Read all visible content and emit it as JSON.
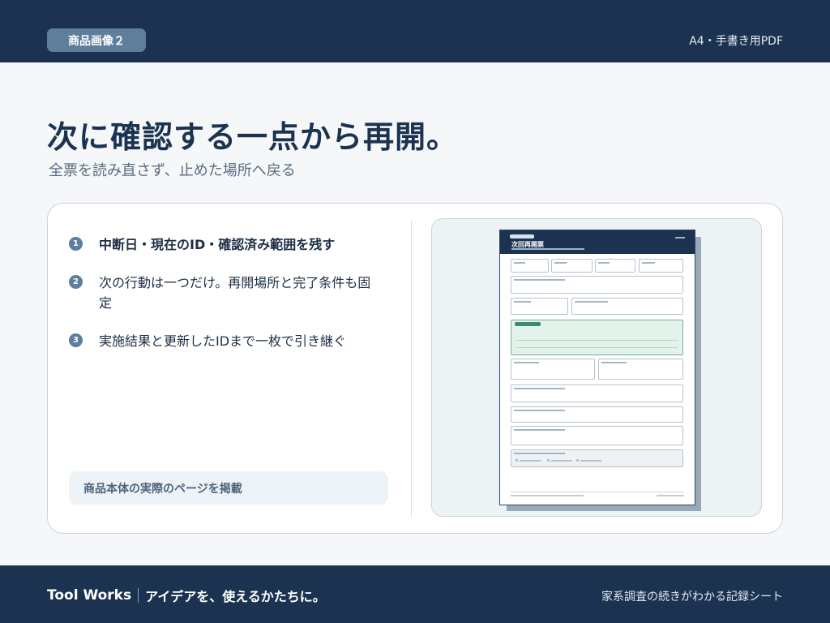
{
  "header": {
    "badge": "商品画像２",
    "right_text": "A4・手書き用PDF"
  },
  "headline": {
    "title": "次に確認する一点から再開。",
    "subtitle": "全票を読み直さず、止めた場所へ戻る"
  },
  "steps": [
    {
      "number": "1",
      "text": "中断日・現在のID・確認済み範囲を残す"
    },
    {
      "number": "2",
      "text": "次の行動は一つだけ。再開場所と完了条件も固定"
    },
    {
      "number": "3",
      "text": "実施結果と更新したIDまで一枚で引き継ぐ"
    }
  ],
  "note": "商品本体の実際のページを掲載",
  "preview": {
    "sheet_title": "次回再開票"
  },
  "footer": {
    "brand": "Tool Works",
    "tagline": "アイデアを、使えるかたちに。",
    "right_text": "家系調査の続きがわかる記録シート"
  },
  "colors": {
    "navy": "#1b3350",
    "badge": "#5f7e9c",
    "highlight": "#e4f2ec"
  }
}
